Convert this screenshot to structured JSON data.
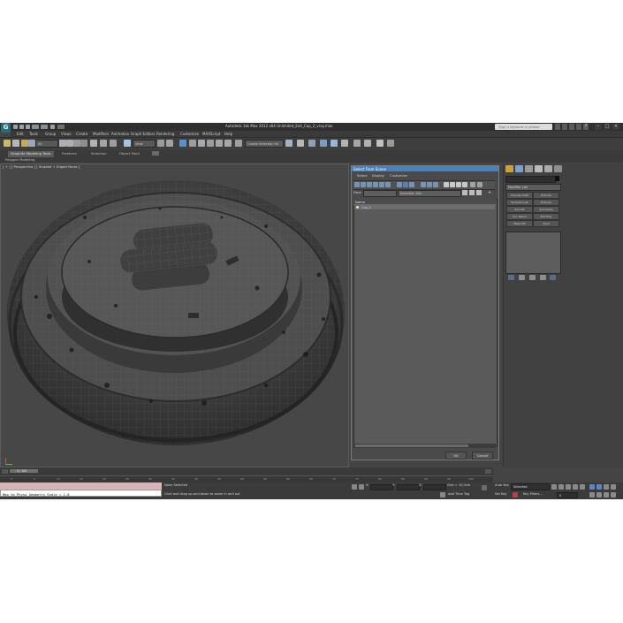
{
  "window": {
    "app_logo_label": "G",
    "title": "Autodesk 3ds Max  2012 x64     Unlimited_Exit_Cap_2_vray.max",
    "search_placeholder": "Type a keyword or phrase",
    "min_label": "–",
    "max_label": "□",
    "close_label": "×"
  },
  "menu": {
    "items": [
      "Edit",
      "Tools",
      "Group",
      "Views",
      "Create",
      "Modifiers",
      "Animation",
      "Graph Editors",
      "Rendering",
      "Customize",
      "MAXScript",
      "Help"
    ]
  },
  "toolbar": {
    "selection_filter": "All",
    "ref_coord": "View",
    "named_selection": "Create Selection Se"
  },
  "ribbon": {
    "tabs": [
      "Graphite Modeling Tools",
      "Freeform",
      "Selection",
      "Object Paint"
    ],
    "sub_label": "Polygon Modeling"
  },
  "viewport": {
    "label": "[ + ] [ Perspective ] [ Shaded + Edged Faces ]"
  },
  "dialog": {
    "title": "Select From Scene",
    "menu": [
      "Select",
      "Display",
      "Customize"
    ],
    "find_label": "Find:",
    "find_value": "",
    "selection_set_label": "Selection Set:",
    "column_name": "Name",
    "objects": [
      "Cap_2"
    ],
    "ok_label": "OK",
    "cancel_label": "Cancel"
  },
  "command_panel": {
    "object_name": "",
    "modifier_list_label": "Modifier List",
    "modifier_buttons": [
      "Unwrap UVW",
      "Extrude",
      "TurboSmooth",
      "Extrude",
      "Smooth",
      "Symmetry",
      "Vol. Select",
      "Edit Poly",
      "MapUVW",
      "Shell"
    ]
  },
  "timeline": {
    "frame_display": "0 / 100",
    "ticks": [
      "0",
      "5",
      "10",
      "15",
      "20",
      "25",
      "30",
      "35",
      "40",
      "45",
      "50",
      "55",
      "60",
      "65",
      "70",
      "75",
      "80",
      "85",
      "90",
      "95",
      "100"
    ]
  },
  "status": {
    "maxscript_output": "",
    "maxscript_listener": "Max to Physx Geometry Scale = 1.0",
    "selection_status": "None Selected",
    "prompt": "Click and drag up-and-down to zoom in and out",
    "x_label": "X:",
    "y_label": "Y:",
    "z_label": "Z:",
    "grid": "Grid = 10,0cm",
    "add_time_tag": "Add Time Tag",
    "auto_key_label": "Auto Key",
    "auto_key_value": "Selected",
    "set_key_label": "Set Key",
    "key_filters_label": "Key Filters...",
    "frame_field": "0"
  },
  "colors": {
    "accent": "#4d80b6",
    "viewport_bg": "#474747",
    "maxscript_output_bg": "#d8b4b8"
  }
}
